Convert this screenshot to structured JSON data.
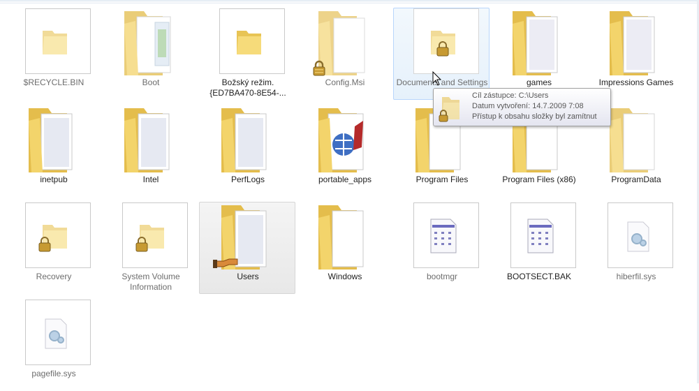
{
  "window": {
    "view": "Large icons"
  },
  "items": [
    {
      "name": "$RECYCLE.BIN",
      "kind": "folder",
      "hidden": true
    },
    {
      "name": "Boot",
      "kind": "folder",
      "hidden": true
    },
    {
      "name": "Božský režim.{ED7BA470-8E54-...",
      "kind": "folder",
      "hidden": true
    },
    {
      "name": "Config.Msi",
      "kind": "folder",
      "hidden": true,
      "locked": true
    },
    {
      "name": "Documents and Settings",
      "kind": "junction",
      "hidden": true,
      "locked": true,
      "state": "hover"
    },
    {
      "name": "games",
      "kind": "folder"
    },
    {
      "name": "Impressions Games",
      "kind": "folder"
    },
    {
      "name": "inetpub",
      "kind": "folder"
    },
    {
      "name": "Intel",
      "kind": "folder"
    },
    {
      "name": "PerfLogs",
      "kind": "folder"
    },
    {
      "name": "portable_apps",
      "kind": "folder"
    },
    {
      "name": "Program Files",
      "kind": "folder"
    },
    {
      "name": "Program Files (x86)",
      "kind": "folder"
    },
    {
      "name": "ProgramData",
      "kind": "folder",
      "hidden": true
    },
    {
      "name": "Recovery",
      "kind": "folder",
      "hidden": true,
      "locked": true
    },
    {
      "name": "System Volume Information",
      "kind": "folder",
      "hidden": true,
      "locked": true
    },
    {
      "name": "Users",
      "kind": "folder",
      "shared": true,
      "state": "selected"
    },
    {
      "name": "Windows",
      "kind": "folder"
    },
    {
      "name": "bootmgr",
      "kind": "file",
      "hidden": true
    },
    {
      "name": "BOOTSECT.BAK",
      "kind": "file"
    },
    {
      "name": "hiberfil.sys",
      "kind": "sysfile",
      "hidden": true
    },
    {
      "name": "pagefile.sys",
      "kind": "sysfile",
      "hidden": true
    }
  ],
  "tooltip": {
    "target_label": "Cíl zástupce: C:\\Users",
    "created_label": "Datum vytvoření: 14.7.2009 7:08",
    "access_label": "Přístup k obsahu složky byl zamítnut"
  },
  "colors": {
    "folder_back": "#e8c454",
    "folder_front": "#f6db7a",
    "hover_border": "#b8d6fb",
    "selected_bg": "#ececec"
  }
}
